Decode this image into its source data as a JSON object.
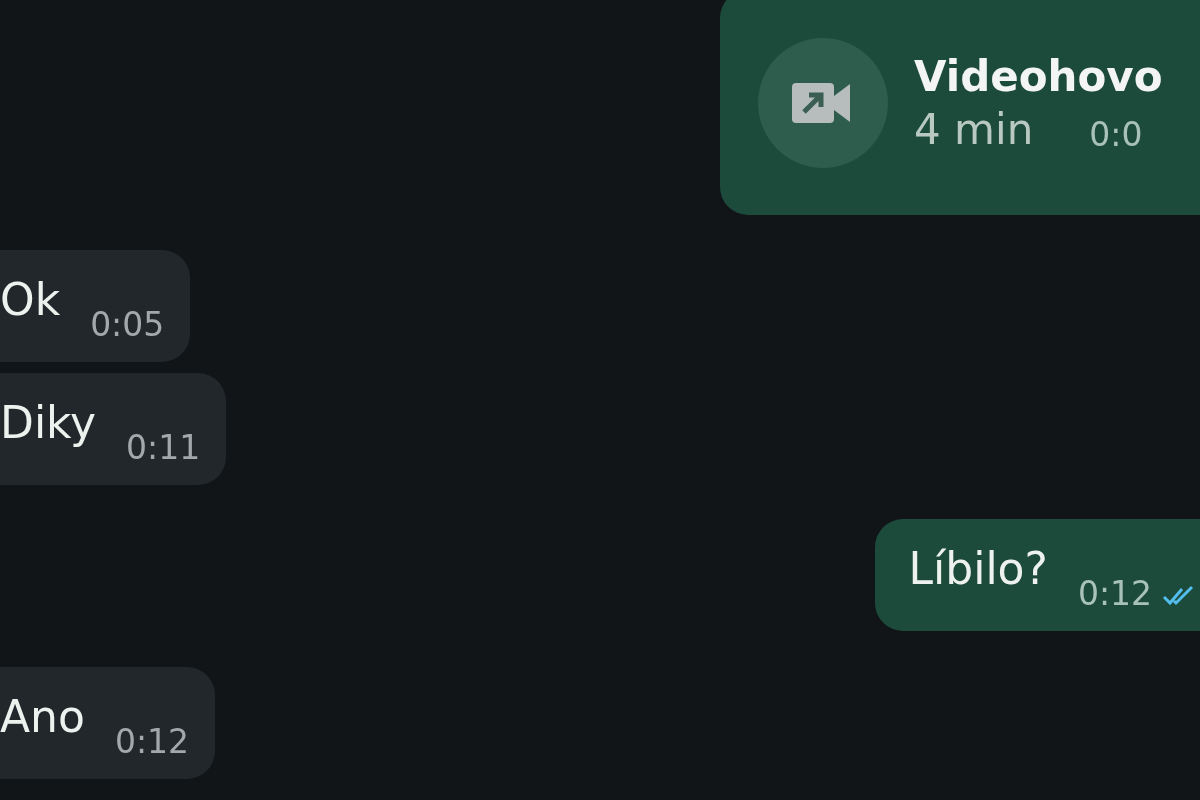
{
  "messages": [
    {
      "kind": "call",
      "outgoing": true,
      "title": "Videohovo",
      "duration": "4 min",
      "time": "0:0"
    },
    {
      "kind": "text",
      "outgoing": false,
      "text": "Ok",
      "time": "0:05"
    },
    {
      "kind": "text",
      "outgoing": false,
      "text": "Diky",
      "time": "0:11"
    },
    {
      "kind": "text",
      "outgoing": true,
      "text": "Líbilo?",
      "time": "0:12",
      "read": true
    },
    {
      "kind": "text",
      "outgoing": false,
      "text": "Ano",
      "time": "0:12"
    }
  ]
}
